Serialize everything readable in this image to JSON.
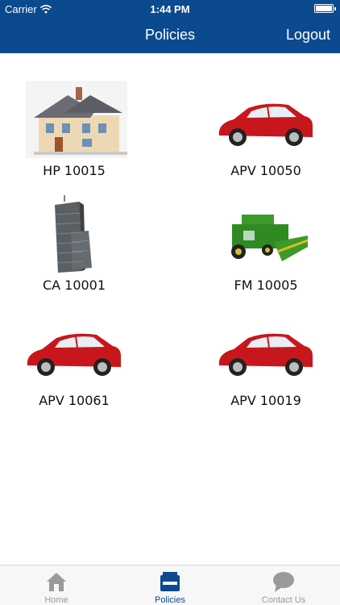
{
  "status_bar": {
    "carrier": "Carrier",
    "time": "1:44 PM"
  },
  "nav": {
    "title": "Policies",
    "logout_label": "Logout"
  },
  "policies": [
    {
      "label": "HP 10015",
      "icon": "house-icon"
    },
    {
      "label": "APV 10050",
      "icon": "car-icon"
    },
    {
      "label": "CA 10001",
      "icon": "building-icon"
    },
    {
      "label": "FM 10005",
      "icon": "combine-harvester-icon"
    },
    {
      "label": "APV 10061",
      "icon": "car-icon"
    },
    {
      "label": "APV 10019",
      "icon": "car-icon"
    }
  ],
  "tabs": [
    {
      "label": "Home",
      "icon": "home-icon",
      "active": false
    },
    {
      "label": "Policies",
      "icon": "inbox-icon",
      "active": true
    },
    {
      "label": "Contact Us",
      "icon": "speech-bubble-icon",
      "active": false
    }
  ],
  "colors": {
    "nav_bar": "#0b4a8f",
    "car_body": "#c8171c",
    "harvester": "#3c9a2a",
    "tab_active": "#0b4a8f",
    "tab_inactive": "#9a9a9a"
  }
}
